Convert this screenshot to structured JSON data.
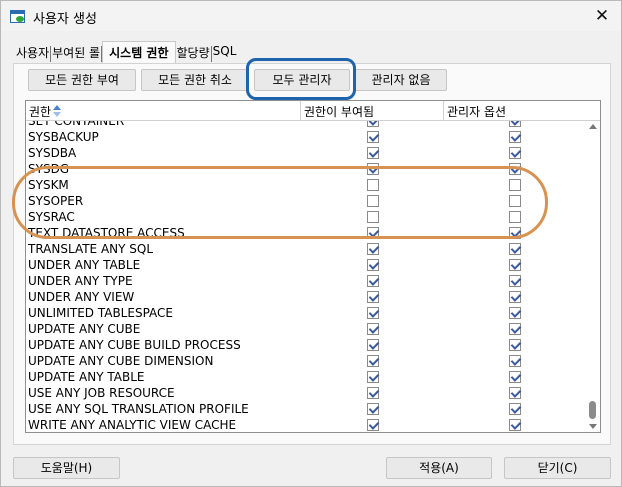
{
  "window": {
    "title": "사용자 생성",
    "close_glyph": "✕"
  },
  "tabs": [
    {
      "label": "사용자",
      "active": false
    },
    {
      "label": "부여된 롤",
      "active": false
    },
    {
      "label": "시스템 권한",
      "active": true
    },
    {
      "label": "할당량",
      "active": false
    },
    {
      "label": "SQL",
      "active": false
    }
  ],
  "toolbar": {
    "grant_all": "모든 권한 부여",
    "revoke_all": "모든 권한 취소",
    "all_admin": "모두 관리자",
    "no_admin": "관리자 없음"
  },
  "grid": {
    "columns": {
      "privilege": "권한",
      "granted": "권한이 부여됨",
      "admin_option": "관리자 옵션"
    },
    "sort_icon": "sort-ascending-icon",
    "rows": [
      {
        "name": "SET CONTAINER",
        "granted": true,
        "admin": true
      },
      {
        "name": "SYSBACKUP",
        "granted": true,
        "admin": true
      },
      {
        "name": "SYSDBA",
        "granted": true,
        "admin": true
      },
      {
        "name": "SYSDG",
        "granted": true,
        "admin": true
      },
      {
        "name": "SYSKM",
        "granted": false,
        "admin": false
      },
      {
        "name": "SYSOPER",
        "granted": false,
        "admin": false
      },
      {
        "name": "SYSRAC",
        "granted": false,
        "admin": false
      },
      {
        "name": "TEXT DATASTORE ACCESS",
        "granted": true,
        "admin": true
      },
      {
        "name": "TRANSLATE ANY SQL",
        "granted": true,
        "admin": true
      },
      {
        "name": "UNDER ANY TABLE",
        "granted": true,
        "admin": true
      },
      {
        "name": "UNDER ANY TYPE",
        "granted": true,
        "admin": true
      },
      {
        "name": "UNDER ANY VIEW",
        "granted": true,
        "admin": true
      },
      {
        "name": "UNLIMITED TABLESPACE",
        "granted": true,
        "admin": true
      },
      {
        "name": "UPDATE ANY CUBE",
        "granted": true,
        "admin": true
      },
      {
        "name": "UPDATE ANY CUBE BUILD PROCESS",
        "granted": true,
        "admin": true
      },
      {
        "name": "UPDATE ANY CUBE DIMENSION",
        "granted": true,
        "admin": true
      },
      {
        "name": "UPDATE ANY TABLE",
        "granted": true,
        "admin": true
      },
      {
        "name": "USE ANY JOB RESOURCE",
        "granted": true,
        "admin": true
      },
      {
        "name": "USE ANY SQL TRANSLATION PROFILE",
        "granted": true,
        "admin": true
      },
      {
        "name": "WRITE ANY ANALYTIC VIEW CACHE",
        "granted": true,
        "admin": true
      }
    ]
  },
  "buttons": {
    "help": "도움말(H)",
    "apply": "적용(A)",
    "close": "닫기(C)"
  },
  "colors": {
    "annotation_blue": "#1e64ac",
    "annotation_orange": "#d69251",
    "checkmark": "#3b5a9a"
  }
}
